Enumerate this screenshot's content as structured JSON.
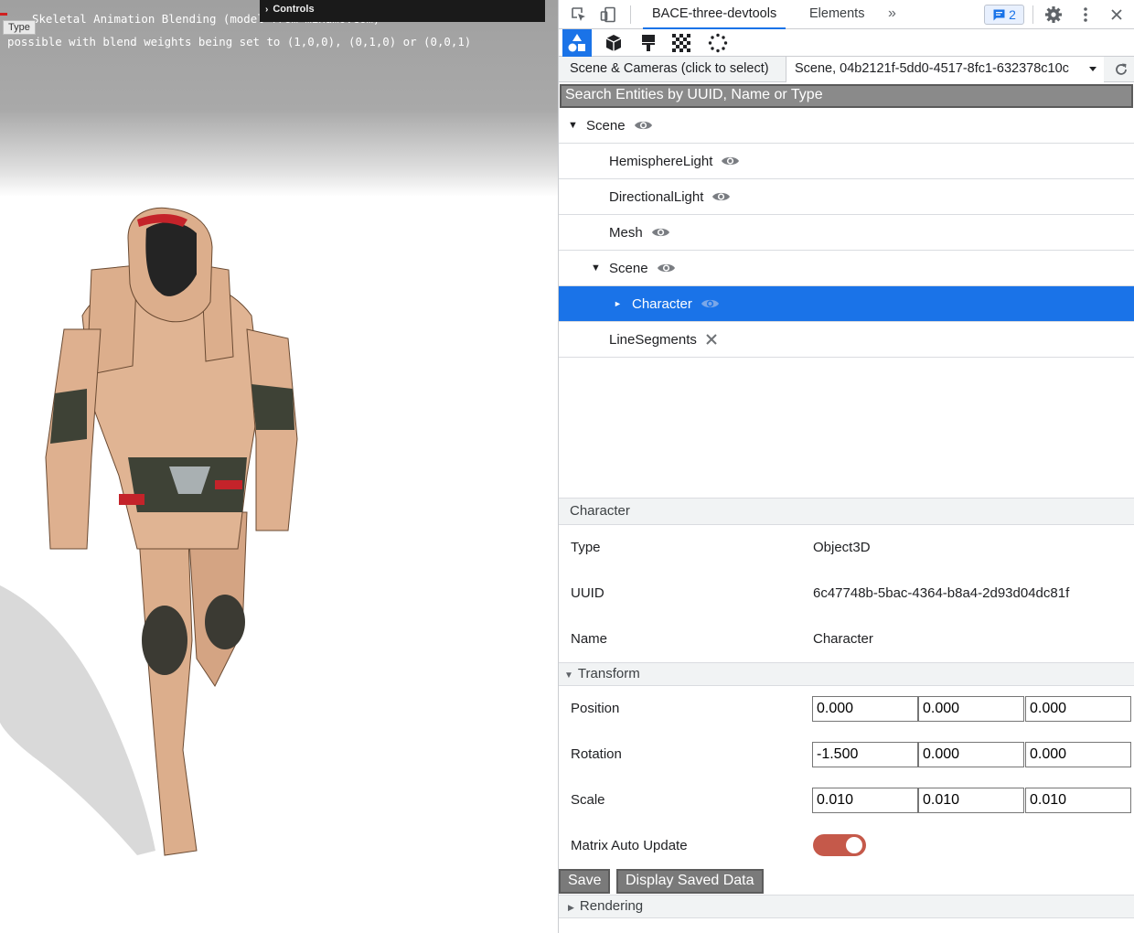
{
  "viewport": {
    "info_line1": "Skeletal Animation Blending (model from mixamo.com)",
    "info_line2": "possible with blend weights being set to (1,0,0), (0,1,0) or (0,0,1)",
    "type_tag": "Type",
    "controls_label": "Controls"
  },
  "devtools": {
    "tabs": {
      "bace": "BACE-three-devtools",
      "elements": "Elements",
      "more": "»"
    },
    "issues_count": "2",
    "tools": [
      "scene-tool-icon",
      "object-cube-icon",
      "brush-icon",
      "checker-texture-icon",
      "spinner-icon"
    ],
    "scene_cameras_label": "Scene & Cameras (click to select)",
    "scene_select_value": "Scene, 04b2121f-5dd0-4517-8fc1-632378c10c",
    "search_placeholder": "Search Entities by UUID, Name or Type",
    "tree": [
      {
        "label": "Scene",
        "visibility": "eye"
      },
      {
        "label": "HemisphereLight",
        "visibility": "eye"
      },
      {
        "label": "DirectionalLight",
        "visibility": "eye"
      },
      {
        "label": "Mesh",
        "visibility": "eye"
      },
      {
        "label": "Scene",
        "visibility": "eye"
      },
      {
        "label": "Character",
        "visibility": "eye",
        "selected": true
      },
      {
        "label": "LineSegments",
        "visibility": "hidden"
      }
    ],
    "details": {
      "header": "Character",
      "type_label": "Type",
      "type_value": "Object3D",
      "uuid_label": "UUID",
      "uuid_value": "6c47748b-5bac-4364-b8a4-2d93d04dc81f",
      "name_label": "Name",
      "name_value": "Character"
    },
    "transform": {
      "header": "Transform",
      "position_label": "Position",
      "position": [
        "0.000",
        "0.000",
        "0.000"
      ],
      "rotation_label": "Rotation",
      "rotation": [
        "-1.500",
        "0.000",
        "0.000"
      ],
      "scale_label": "Scale",
      "scale": [
        "0.010",
        "0.010",
        "0.010"
      ],
      "matrix_auto_update_label": "Matrix Auto Update",
      "matrix_auto_update": true
    },
    "buttons": {
      "save": "Save",
      "display_saved": "Display Saved Data"
    },
    "rendering_header": "Rendering",
    "colors": {
      "accent": "#1a73e8",
      "toggle_on": "#c5594a"
    }
  }
}
